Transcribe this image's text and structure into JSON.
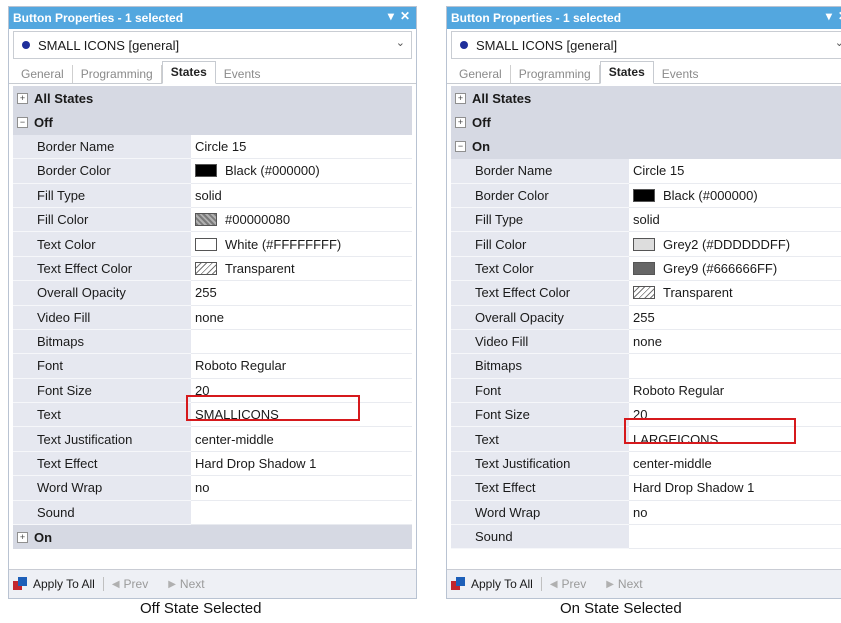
{
  "left": {
    "title": "Button Properties - 1 selected",
    "object": "SMALL ICONS [general]",
    "tabs": [
      "General",
      "Programming",
      "States",
      "Events"
    ],
    "groups": {
      "all_states": "All States",
      "off": "Off",
      "on": "On"
    },
    "props": [
      {
        "name": "Border Name",
        "value": "Circle 15"
      },
      {
        "name": "Border Color",
        "value": "Black (#000000)",
        "swatch": "#000000"
      },
      {
        "name": "Fill Type",
        "value": "solid"
      },
      {
        "name": "Fill Color",
        "value": "#00000080",
        "swatch": "hatch"
      },
      {
        "name": "Text Color",
        "value": "White (#FFFFFFFF)",
        "swatch": "#FFFFFF"
      },
      {
        "name": "Text Effect Color",
        "value": "Transparent",
        "swatch": "transparent"
      },
      {
        "name": "Overall Opacity",
        "value": "255"
      },
      {
        "name": "Video Fill",
        "value": "none"
      },
      {
        "name": "Bitmaps",
        "value": ""
      },
      {
        "name": "Font",
        "value": "Roboto Regular"
      },
      {
        "name": "Font Size",
        "value": "20"
      },
      {
        "name": "Text",
        "value": "SMALLICONS"
      },
      {
        "name": "Text Justification",
        "value": "center-middle"
      },
      {
        "name": "Text Effect",
        "value": "Hard Drop Shadow 1"
      },
      {
        "name": "Word Wrap",
        "value": "no"
      },
      {
        "name": "Sound",
        "value": ""
      }
    ],
    "apply_label": "Apply To All",
    "prev_label": "Prev",
    "next_label": "Next",
    "caption": "Off State Selected"
  },
  "right": {
    "title": "Button Properties - 1 selected",
    "object": "SMALL ICONS [general]",
    "tabs": [
      "General",
      "Programming",
      "States",
      "Events"
    ],
    "groups": {
      "all_states": "All States",
      "off": "Off",
      "on": "On"
    },
    "props": [
      {
        "name": "Border Name",
        "value": "Circle 15"
      },
      {
        "name": "Border Color",
        "value": "Black (#000000)",
        "swatch": "#000000"
      },
      {
        "name": "Fill Type",
        "value": "solid"
      },
      {
        "name": "Fill Color",
        "value": "Grey2 (#DDDDDDFF)",
        "swatch": "#DDDDDD"
      },
      {
        "name": "Text Color",
        "value": "Grey9 (#666666FF)",
        "swatch": "#666666"
      },
      {
        "name": "Text Effect Color",
        "value": "Transparent",
        "swatch": "transparent"
      },
      {
        "name": "Overall Opacity",
        "value": "255"
      },
      {
        "name": "Video Fill",
        "value": "none"
      },
      {
        "name": "Bitmaps",
        "value": ""
      },
      {
        "name": "Font",
        "value": "Roboto Regular"
      },
      {
        "name": "Font Size",
        "value": "20"
      },
      {
        "name": "Text",
        "value": "LARGEICONS"
      },
      {
        "name": "Text Justification",
        "value": "center-middle"
      },
      {
        "name": "Text Effect",
        "value": "Hard Drop Shadow 1"
      },
      {
        "name": "Word Wrap",
        "value": "no"
      },
      {
        "name": "Sound",
        "value": ""
      }
    ],
    "apply_label": "Apply To All",
    "prev_label": "Prev",
    "next_label": "Next",
    "caption": "On State Selected"
  },
  "colors": {
    "titlebar": "#53a7df",
    "highlight": "#d6191c",
    "group_bg": "#d6d9e3",
    "name_bg": "#e6e8f0"
  }
}
